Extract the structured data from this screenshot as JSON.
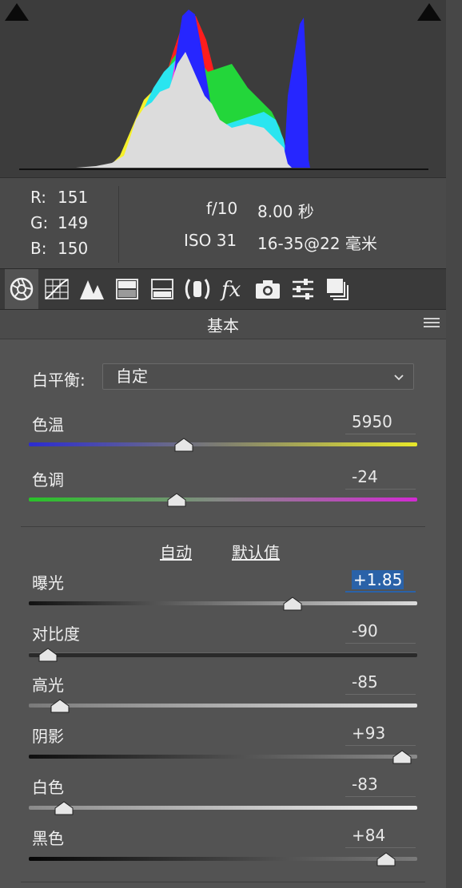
{
  "info": {
    "rgb": [
      {
        "label": "R:",
        "value": "151"
      },
      {
        "label": "G:",
        "value": "149"
      },
      {
        "label": "B:",
        "value": "150"
      }
    ],
    "aperture": "f/10",
    "shutter": "8.00 秒",
    "iso": "ISO 31",
    "lens": "16-35@22 毫米"
  },
  "tabs": [
    {
      "icon": "aperture-icon",
      "active": true
    },
    {
      "icon": "tone-curve-icon",
      "active": false
    },
    {
      "icon": "detail-icon",
      "active": false
    },
    {
      "icon": "hsl-icon",
      "active": false
    },
    {
      "icon": "split-toning-icon",
      "active": false
    },
    {
      "icon": "lens-corrections-icon",
      "active": false
    },
    {
      "icon": "fx-icon",
      "active": false
    },
    {
      "icon": "camera-calibration-icon",
      "active": false
    },
    {
      "icon": "presets-icon",
      "active": false
    },
    {
      "icon": "snapshots-icon",
      "active": false
    }
  ],
  "panel": {
    "title": "基本"
  },
  "white_balance": {
    "label": "白平衡:",
    "value": "自定"
  },
  "temperature": {
    "label": "色温",
    "value": "5950",
    "position": 0.4
  },
  "tint": {
    "label": "色调",
    "value": "-24",
    "position": 0.38
  },
  "actions": {
    "auto": "自动",
    "default": "默认值"
  },
  "exposure": {
    "label": "曝光",
    "value": "+1.85",
    "position": 0.68
  },
  "contrast": {
    "label": "对比度",
    "value": "-90",
    "position": 0.05
  },
  "highlights": {
    "label": "高光",
    "value": "-85",
    "position": 0.08
  },
  "shadows": {
    "label": "阴影",
    "value": "+93",
    "position": 0.96
  },
  "whites": {
    "label": "白色",
    "value": "-83",
    "position": 0.09
  },
  "blacks": {
    "label": "黑色",
    "value": "+84",
    "position": 0.92
  },
  "colors": {
    "accent": "#2a62a8",
    "background": "#535353"
  }
}
